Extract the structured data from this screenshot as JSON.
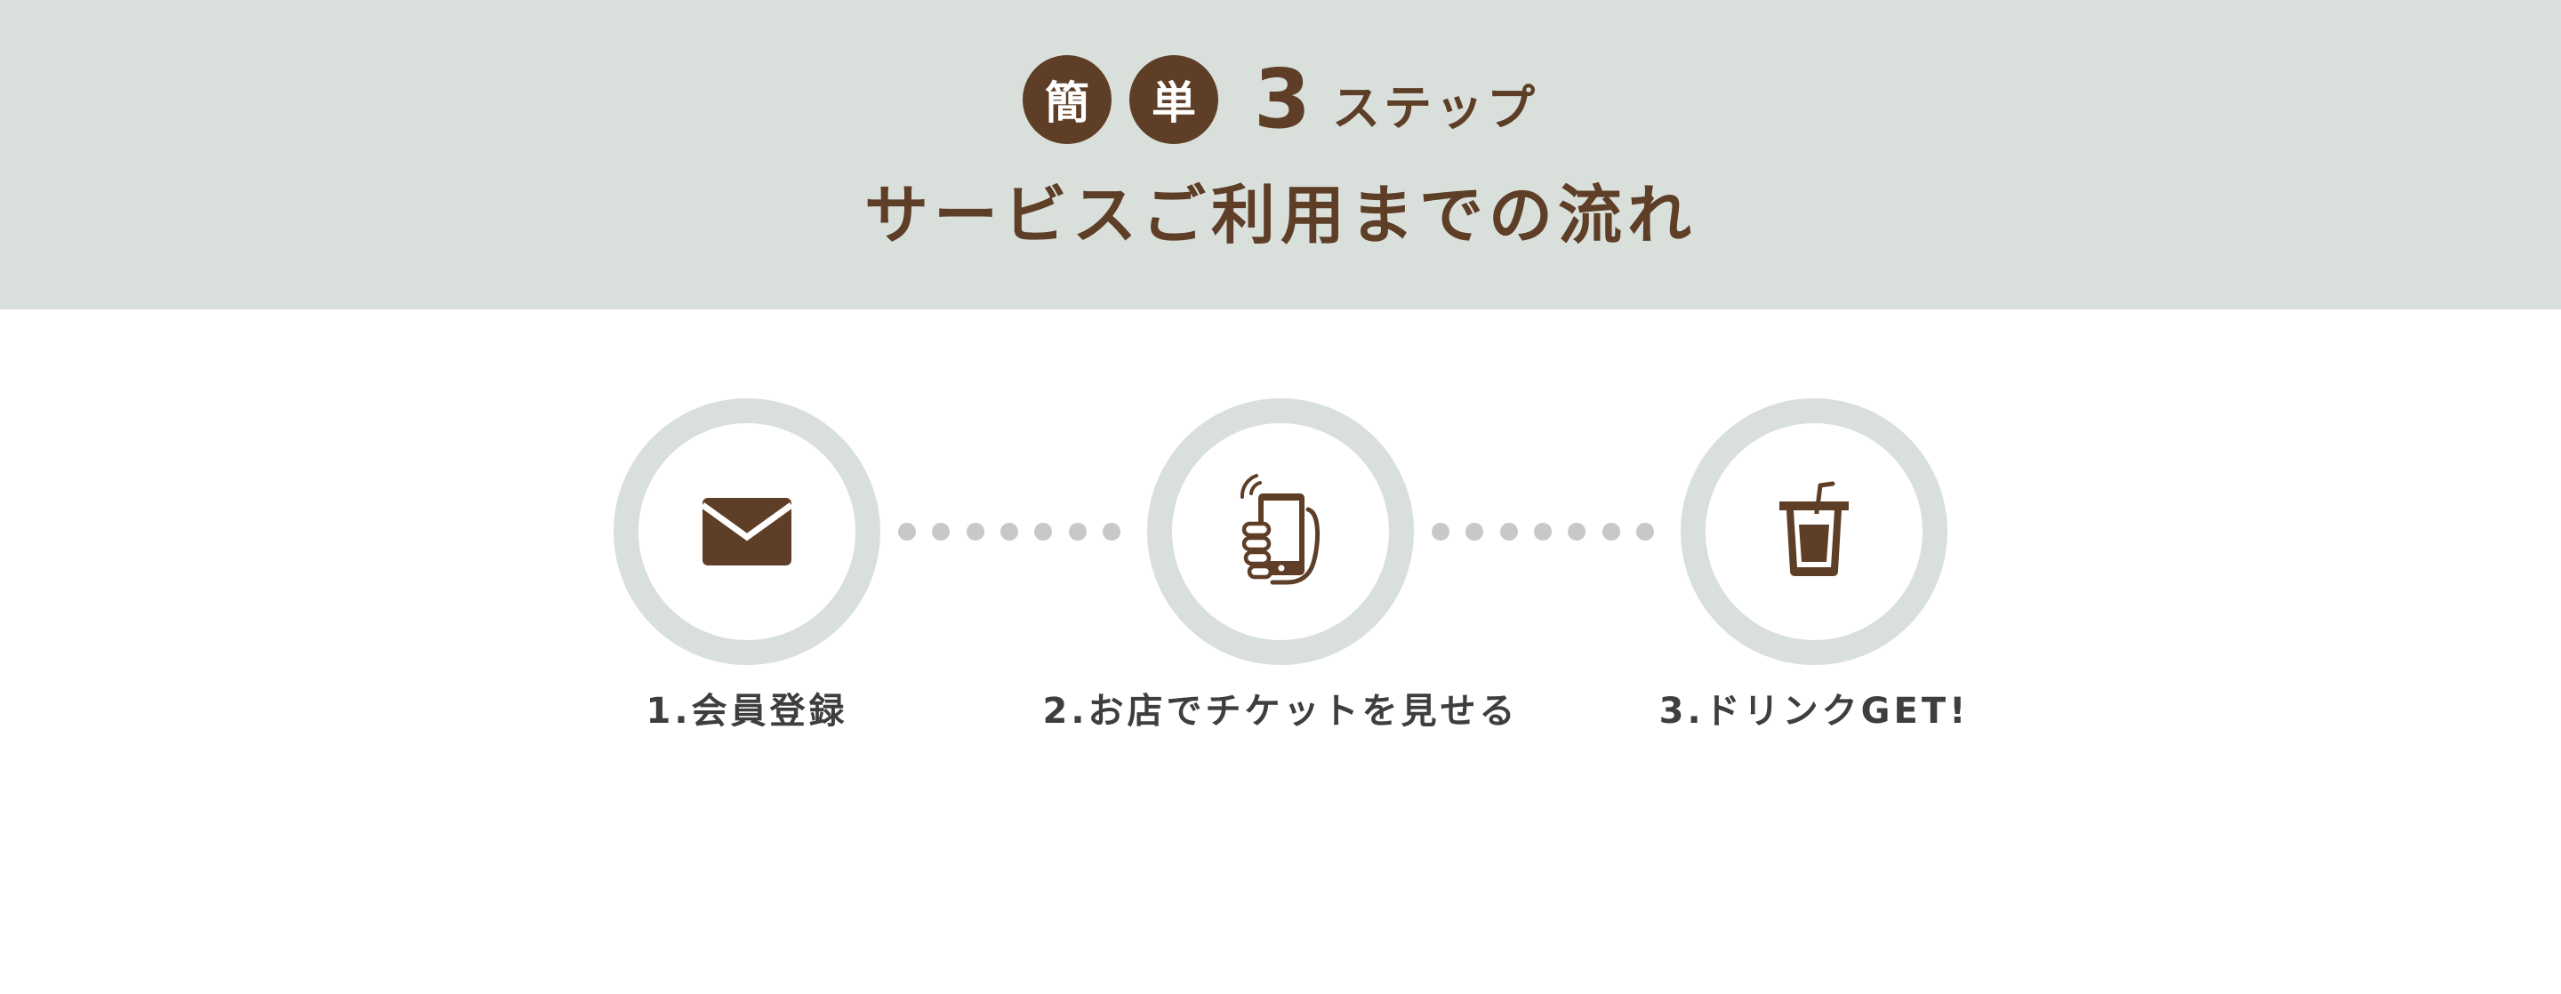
{
  "header": {
    "badges": [
      "簡",
      "単"
    ],
    "step_count": "3",
    "step_word": "ステップ",
    "title": "サービスご利用までの流れ"
  },
  "steps": [
    {
      "label": "1.会員登録",
      "icon": "envelope-icon"
    },
    {
      "label": "2.お店でチケットを見せる",
      "icon": "phone-in-hand-icon"
    },
    {
      "label": "3.ドリンクGET!",
      "icon": "drink-cup-icon"
    }
  ],
  "colors": {
    "brown": "#5e3e26",
    "band": "#d9e0dc",
    "dot": "#c8c8c8",
    "label": "#3e3e3e"
  }
}
